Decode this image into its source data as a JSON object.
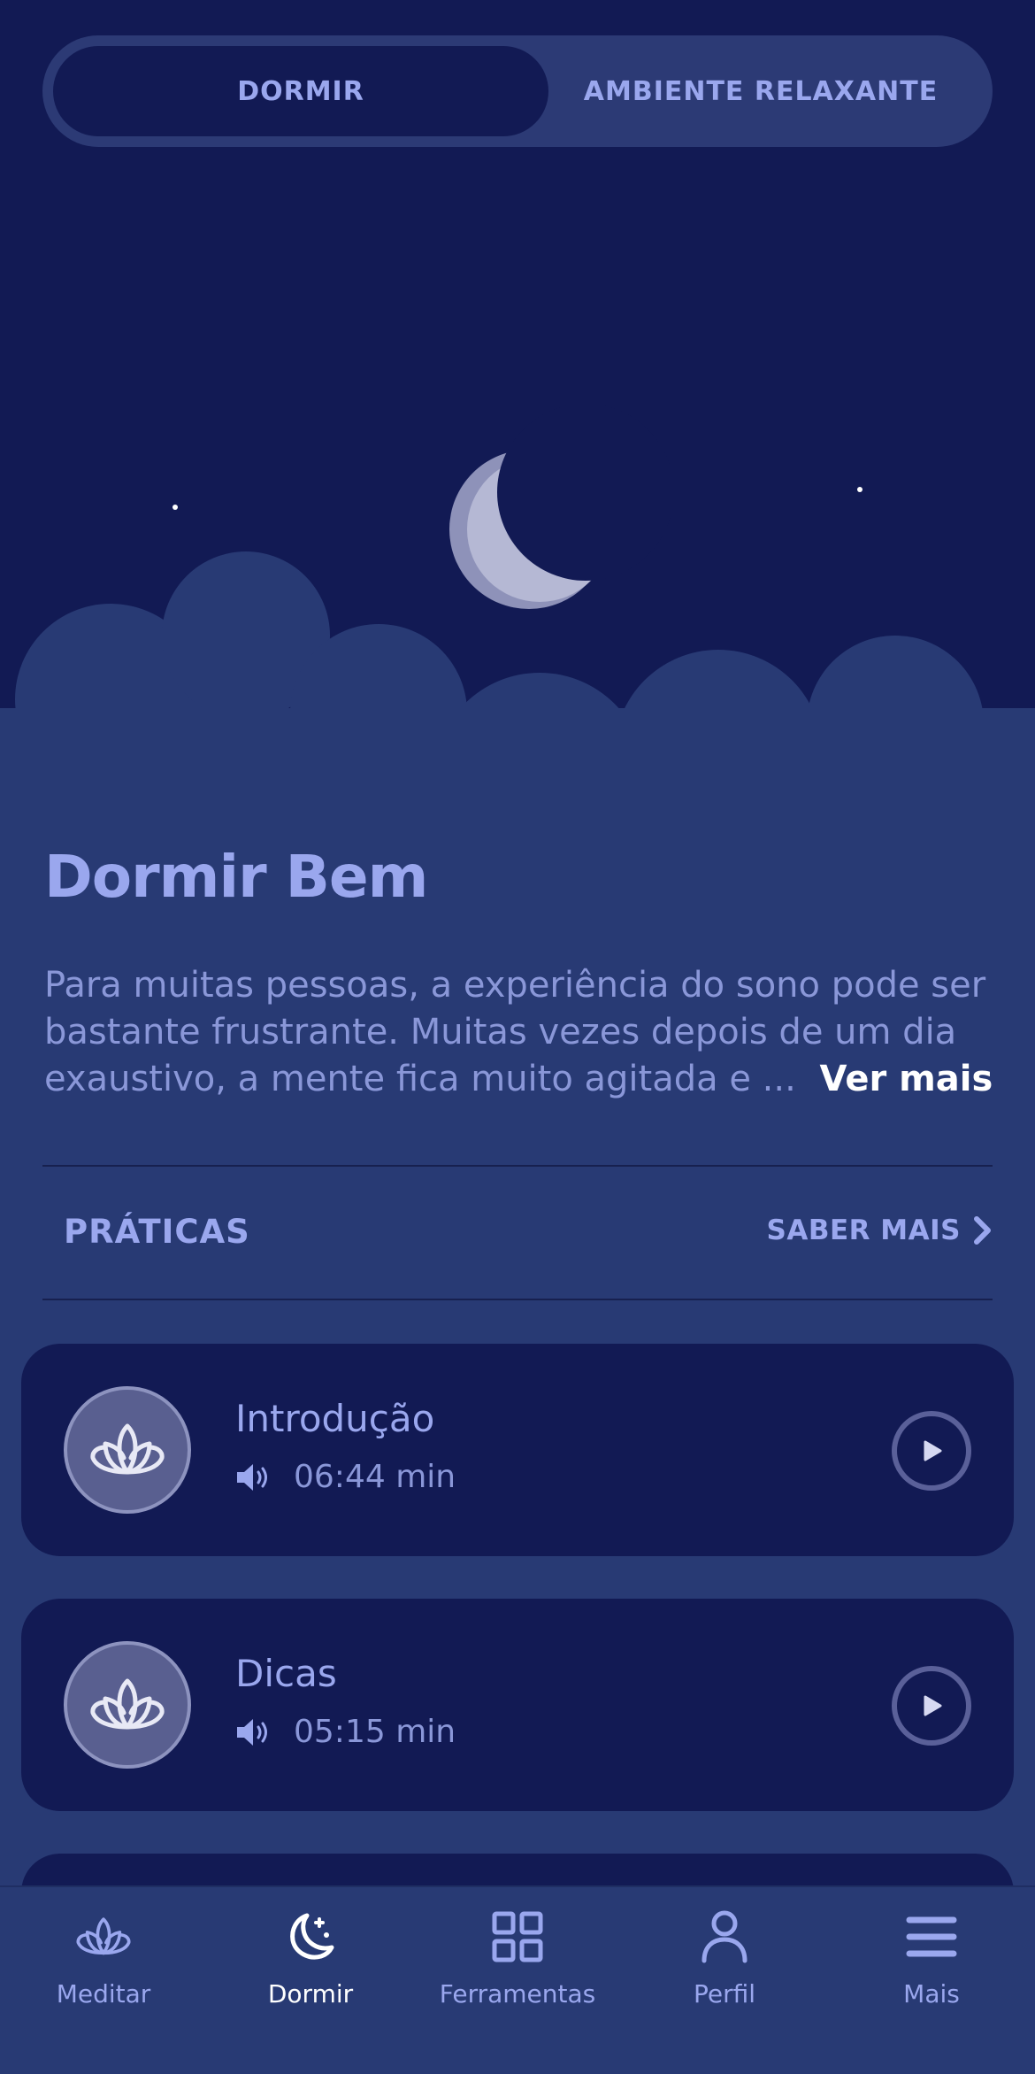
{
  "segment": {
    "active_label": "DORMIR",
    "inactive_label": "AMBIENTE RELAXANTE"
  },
  "content": {
    "title": "Dormir Bem",
    "description": "Para muitas pessoas, a experiência do sono pode ser bastante frustrante. Muitas vezes depois de um dia exaustivo, a mente fica muito agitada e ...",
    "see_more": "Ver mais"
  },
  "section": {
    "label": "PRÁTICAS",
    "learn_more": "SABER MAIS"
  },
  "practices": [
    {
      "title": "Introdução",
      "duration": "06:44 min",
      "icon": "lotus-icon"
    },
    {
      "title": "Dicas",
      "duration": "05:15 min",
      "icon": "lotus-icon"
    }
  ],
  "nav": {
    "items": [
      {
        "label": "Meditar",
        "icon": "lotus-icon"
      },
      {
        "label": "Dormir",
        "icon": "moon-icon",
        "active": true
      },
      {
        "label": "Ferramentas",
        "icon": "grid-icon"
      },
      {
        "label": "Perfil",
        "icon": "person-icon"
      },
      {
        "label": "Mais",
        "icon": "menu-icon"
      }
    ]
  },
  "colors": {
    "background": "#283a74",
    "night_sky": "#121a54",
    "accent_text": "#9aa7ee",
    "active_nav": "#ffffff"
  }
}
